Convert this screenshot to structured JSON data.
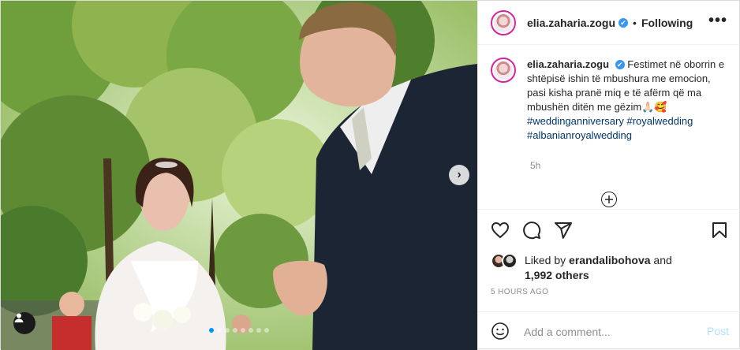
{
  "header": {
    "username": "elia.zaharia.zogu",
    "verified_glyph": "✔",
    "separator": "•",
    "follow_status": "Following",
    "more_glyph": "•••"
  },
  "caption": {
    "username": "elia.zaharia.zogu",
    "text": "Festimet në oborrin e shtëpisë ishin të mbushura me emocion, pasi kisha pranë miq e të afërm që ma mbushën ditën me gëzim🙏🏻🥰",
    "hashtags": [
      "#weddinganniversary",
      "#royalwedding",
      "#albanianroyalwedding"
    ],
    "time": "5h"
  },
  "media": {
    "next_glyph": "›",
    "carousel": {
      "count": 8,
      "active_index": 0
    }
  },
  "actions": {
    "icons": [
      "heart-icon",
      "comment-icon",
      "share-icon",
      "bookmark-icon"
    ]
  },
  "likes": {
    "prefix": "Liked by",
    "user": "erandalibohova",
    "conjunction": "and",
    "others": "1,992 others"
  },
  "timestamp": "5 HOURS AGO",
  "comment_box": {
    "placeholder": "Add a comment...",
    "post_label": "Post"
  },
  "colors": {
    "verified": "#3897f0",
    "link": "#00376b",
    "post_disabled": "#b2dffc",
    "story_ring": "#d6249f"
  }
}
